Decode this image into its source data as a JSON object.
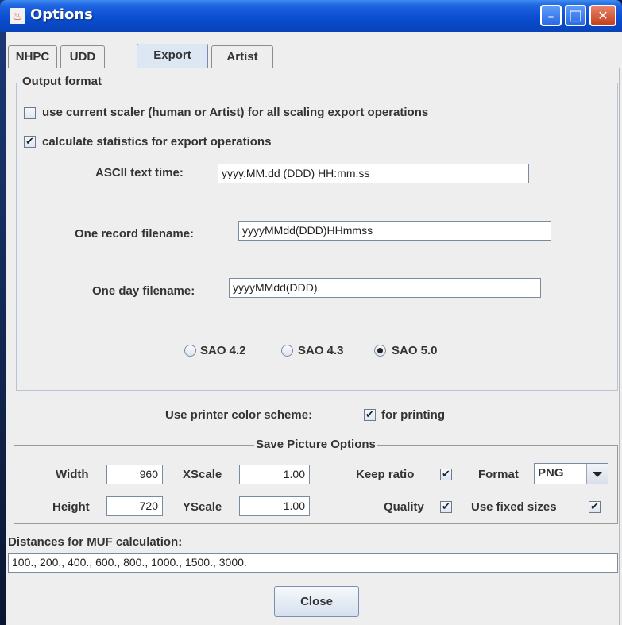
{
  "window": {
    "title": "Options",
    "minimize_symbol": "–",
    "maximize_symbol": "□",
    "close_symbol": "✕"
  },
  "tabs": [
    {
      "label": "NHPC",
      "selected": false
    },
    {
      "label": "UDD",
      "selected": false
    },
    {
      "label": "Export",
      "selected": true
    },
    {
      "label": "Artist",
      "selected": false
    }
  ],
  "output_format": {
    "legend": "Output format",
    "use_current_scaler": {
      "label": "use current scaler (human or Artist) for all scaling export operations",
      "checked": false
    },
    "calc_statistics": {
      "label": "calculate statistics for export operations",
      "checked": true
    },
    "ascii_time": {
      "label": "ASCII text time:",
      "value": "yyyy.MM.dd (DDD) HH:mm:ss"
    },
    "one_record": {
      "label": "One record filename:",
      "value": "yyyyMMdd(DDD)HHmmss"
    },
    "one_day": {
      "label": "One day filename:",
      "value": "yyyyMMdd(DDD)"
    },
    "sao": {
      "options": [
        "SAO 4.2",
        "SAO 4.3",
        "SAO 5.0"
      ],
      "selected": "SAO 5.0"
    }
  },
  "printer": {
    "label": "Use printer color scheme:",
    "checkbox_label": "for printing",
    "checked": true
  },
  "save_picture": {
    "legend": "Save Picture Options",
    "width_label": "Width",
    "width": "960",
    "height_label": "Height",
    "height": "720",
    "xscale_label": "XScale",
    "xscale": "1.00",
    "yscale_label": "YScale",
    "yscale": "1.00",
    "keep_ratio_label": "Keep ratio",
    "keep_ratio": true,
    "quality_label": "Quality",
    "quality": true,
    "format_label": "Format",
    "format": "PNG",
    "fixed_sizes_label": "Use fixed sizes",
    "fixed_sizes": true
  },
  "muf": {
    "label": "Distances for MUF calculation:",
    "value": "100., 200., 400., 600., 800., 1000., 1500., 3000."
  },
  "close_button": "Close",
  "check_glyph": "✔",
  "colors": {
    "titlebar": "#0a4ed2",
    "client": "#eeeeee",
    "close_button": "#c6401c"
  }
}
